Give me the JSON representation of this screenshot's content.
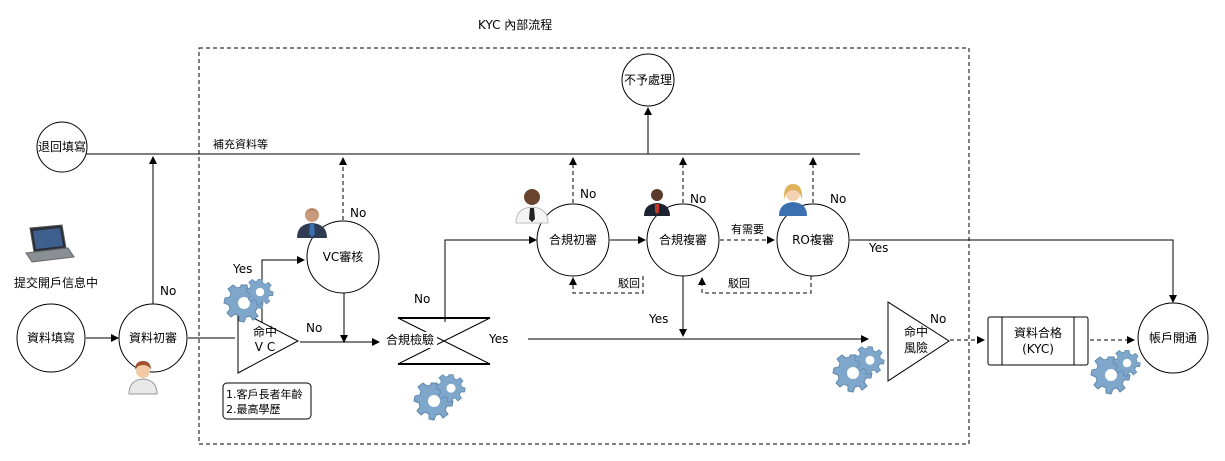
{
  "diagram": {
    "title": "KYC 內部流程",
    "nodes": {
      "data_entry": "資料填寫",
      "data_initial_review": "資料初審",
      "return_fill": "退回填寫",
      "submit_account": "提交開戶信息中",
      "vc_review": "VC審核",
      "no_process": "不予處理",
      "compliance_initial": "合規初審",
      "compliance_second": "合規複審",
      "ro_second": "RO複審",
      "account_open": "帳戶開通",
      "data_qualified_line1": "資料合格",
      "data_qualified_line2": "(KYC)",
      "hit_vc_line1": "命中",
      "hit_vc_line2": "V C",
      "hit_risk_line1": "命中",
      "hit_risk_line2": "風險",
      "compliance_check": "合規檢驗",
      "criteria_line1": "1.客戶長者年齡",
      "criteria_line2": "2.最高學歷"
    },
    "edge_labels": {
      "supplement": "補充資料等",
      "no_initial_review": "No",
      "no_vc_reviewer": "No",
      "yes_hit_vc": "Yes",
      "no_hit_vc": "No",
      "no_check_upper": "No",
      "yes_check": "Yes",
      "no_ci": "No",
      "no_cs": "No",
      "no_ro": "No",
      "as_needed": "有需要",
      "reject_1": "駁回",
      "reject_2": "駁回",
      "yes_cs_down": "Yes",
      "yes_ro": "Yes",
      "no_risk": "No"
    },
    "icons": {
      "laptop": "laptop-icon",
      "gear": "gear-icon",
      "female_user": "female-user-icon",
      "male_user": "male-user-icon"
    },
    "colors": {
      "line": "#000000",
      "gear": "#7fa7cc",
      "suit": "#2f3b52",
      "tie_blue": "#3b6fb0"
    }
  }
}
